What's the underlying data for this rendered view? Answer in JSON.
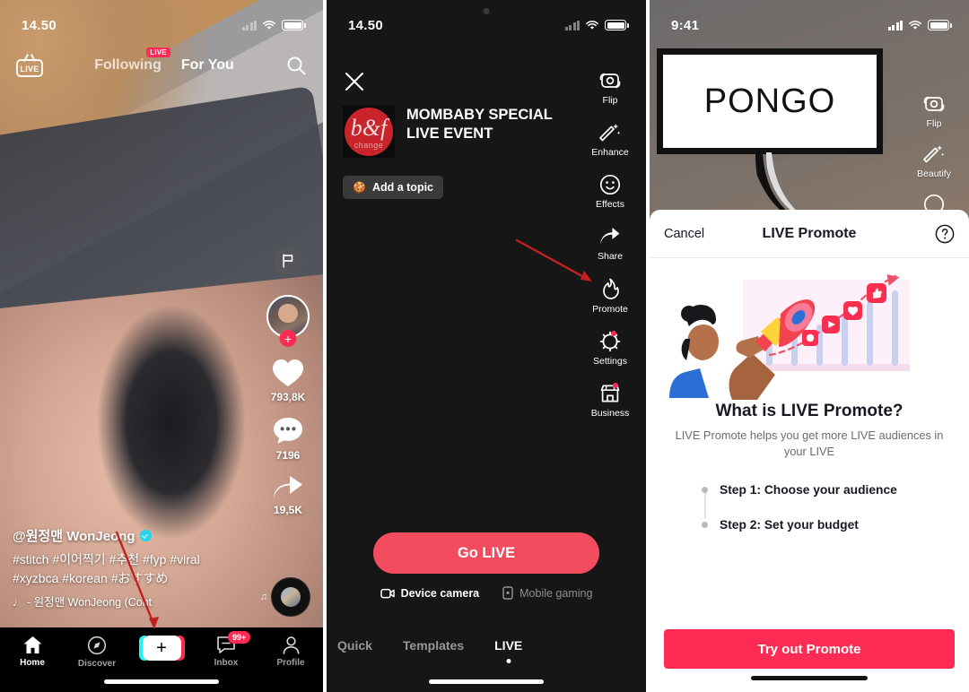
{
  "panel1": {
    "status": {
      "time": "14.50",
      "wifi_icon": "wifi-icon",
      "battery_icon": "battery-icon"
    },
    "live_badge_label": "LIVE",
    "tabs": [
      {
        "label": "Following",
        "badge": "LIVE",
        "active": false
      },
      {
        "label": "For You",
        "badge": "",
        "active": true
      }
    ],
    "search_icon": "search-icon",
    "rail": {
      "flag_icon": "flag-icon",
      "follow_plus": "+",
      "like_count": "793,8K",
      "comment_count": "7196",
      "share_count": "19,5K"
    },
    "caption": {
      "username": "@원정맨 WonJeong",
      "hashtags_line1": "#stitch #이어찍기 #추천 #fyp #viral",
      "hashtags_line2": "#xyzbca #korean #おすすめ",
      "music": "♩ - 원정맨 WonJeong (Cont"
    },
    "tabbar": [
      {
        "label": "Home",
        "icon": "home-icon",
        "badge": "",
        "active": true
      },
      {
        "label": "Discover",
        "icon": "compass-icon",
        "badge": "",
        "active": false
      },
      {
        "label": "",
        "icon": "plus-icon",
        "badge": "",
        "active": false
      },
      {
        "label": "Inbox",
        "icon": "inbox-icon",
        "badge": "99+",
        "active": false
      },
      {
        "label": "Profile",
        "icon": "person-icon",
        "badge": "",
        "active": false
      }
    ]
  },
  "panel2": {
    "status": {
      "time": "14.50",
      "wifi_icon": "wifi-icon",
      "battery_icon": "battery-icon"
    },
    "close_icon": "close-icon",
    "live_title": "MOMBABY SPECIAL LIVE EVENT",
    "thumb": {
      "mark": "b&f",
      "sub": "change"
    },
    "topic_chip": {
      "emoji": "🍪",
      "label": "Add a topic"
    },
    "rail": [
      {
        "label": "Flip",
        "icon": "flip-camera-icon",
        "dot": false
      },
      {
        "label": "Enhance",
        "icon": "magic-wand-icon",
        "dot": false
      },
      {
        "label": "Effects",
        "icon": "smiley-icon",
        "dot": false
      },
      {
        "label": "Share",
        "icon": "share-arrow-icon",
        "dot": false
      },
      {
        "label": "Promote",
        "icon": "flame-icon",
        "dot": false
      },
      {
        "label": "Settings",
        "icon": "gear-icon",
        "dot": true
      },
      {
        "label": "Business",
        "icon": "storefront-icon",
        "dot": true
      }
    ],
    "go_live_label": "Go LIVE",
    "modes": [
      {
        "label": "Device camera",
        "icon": "camera-icon",
        "active": true
      },
      {
        "label": "Mobile gaming",
        "icon": "phone-icon",
        "active": false
      }
    ],
    "tabs": [
      {
        "label": "Quick",
        "active": false
      },
      {
        "label": "Templates",
        "active": false
      },
      {
        "label": "LIVE",
        "active": true
      }
    ]
  },
  "panel3": {
    "status": {
      "time": "9:41",
      "cellular_icon": "signal-bars-icon",
      "wifi_icon": "wifi-icon",
      "battery_icon": "battery-icon"
    },
    "bubble_text": "PONGO",
    "rail": [
      {
        "label": "Flip",
        "icon": "flip-camera-icon"
      },
      {
        "label": "Beautify",
        "icon": "magic-wand-icon"
      }
    ],
    "sheet": {
      "cancel_label": "Cancel",
      "title": "LIVE Promote",
      "help_icon": "question-circle-icon",
      "illustration": "promote-megaphone-chart-illustration",
      "heading": "What is LIVE Promote?",
      "subtitle": "LIVE Promote helps you get more LIVE audiences in your LIVE",
      "steps": [
        "Step 1: Choose your audience",
        "Step 2: Set your budget"
      ],
      "cta_label": "Try out Promote"
    }
  },
  "annotations": {
    "accent_red": "#d32b2b",
    "brand_red": "#fe2c55",
    "go_live_red": "#f24c5e"
  }
}
